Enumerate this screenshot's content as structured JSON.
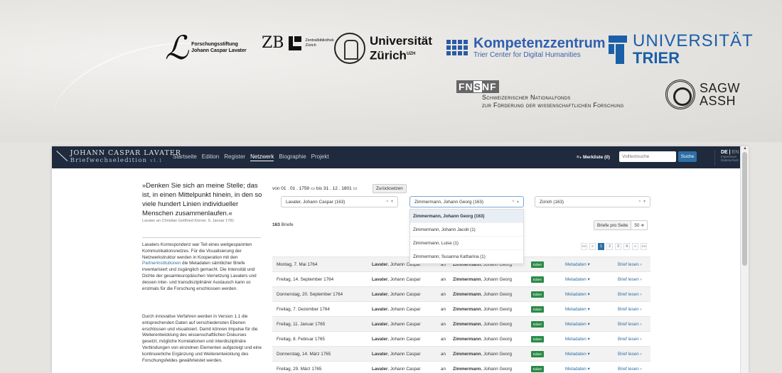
{
  "logos": {
    "lavater": {
      "line1": "Forschungsstiftung",
      "line2": "Johann Caspar Lavater"
    },
    "zb": {
      "mark": "ZB",
      "line1": "Zentralbibliothek",
      "line2": "Zürich"
    },
    "uzh": {
      "line1": "Universität",
      "line2": "Zürich",
      "sup": "UZH"
    },
    "kompetenz": {
      "line1": "Kompetenzzentrum",
      "line2": "Trier Center for Digital Humanities"
    },
    "trier": {
      "line1": "UNIVERSITÄT",
      "line2": "TRIER"
    },
    "snf": {
      "abbr_a": "FN",
      "abbr_b": "S",
      "abbr_c": "NF",
      "line1": "Schweizerischer Nationalfonds",
      "line2": "zur Förderung der wissenschaftlichen Forschung"
    },
    "sagw": {
      "line1": "SAGW",
      "line2": "ASSH"
    }
  },
  "nav": {
    "title": "JOHANN CASPAR LAVATER",
    "subtitle": "Briefwechseledition",
    "version": "v1.1",
    "items": [
      "Startseite",
      "Edition",
      "Register",
      "Netzwerk",
      "Biographie",
      "Projekt"
    ],
    "active": "Netzwerk",
    "merkliste": "≡₊ Merkliste (0)",
    "search_placeholder": "Volltextsuche",
    "search_button": "Suche",
    "lang_de": "DE",
    "lang_en": "EN",
    "impressum": "Impressum",
    "datenschutz": "Datenschutz"
  },
  "sidebar": {
    "quote": "»Denken Sie sich an meine Stelle; das ist, in einen Mittelpunkt hinein, in den so viele hundert Linien individueller Menschen zusammenlaufen.«",
    "quote_source": "Lavater an Christian Gottfried Körner, 9. Januar 1781",
    "para1_a": "Lavaters Korrespondenz war Teil eines weitgespannten Kommunikationsnetzes. Für die Visualisierung der Netzwerkstruktur werden in Kooperation mit den ",
    "para1_link": "Partnerinstitutionen",
    "para1_b": " die Metadaten sämtlicher Briefe inventarisiert und zugänglich gemacht. Die Intensität und Dichte der gesamteuropäischen Vernetzung Lavaters und dessen inter- und transdisziplinärer Austausch kann so erstmals für die Forschung erschlossen werden.",
    "para2": "Durch innovative Verfahren werden in Version 1.1 die entsprechenden Daten auf verschiedensten Ebenen erschlossen und visualisiert. Damit können Impulse für die Weiterentwicklung des wissenschaftlichen Diskurses gesetzt, mögliche Korrelationen und interdisziplinäre Verbindungen von einzelnen Elementen aufgezeigt und eine kontinuierliche Ergänzung und Weiterentwicklung des Forschungsfeldes gewährleistet werden."
  },
  "filters": {
    "von_label": "von",
    "von": "01 . 01 . 1759",
    "bis_label": "bis",
    "bis": "31 . 12 . 1801",
    "reset": "Zurücksetzen",
    "sender": "Lavater, Johann Caspar (163)",
    "recipient": "Zimmermann, Johann Georg (163)",
    "place": "Zürich (163)",
    "dropdown": [
      "Zimmermann, Johann Georg (163)",
      "Zimmermann, Johann Jacob (1)",
      "Zimmermann, Luise (1)",
      "Zimmermann, Susanna Katharina (1)"
    ]
  },
  "results": {
    "count": "163",
    "count_label": "Briefe",
    "per_page_label": "Briefe pro Seite",
    "per_page": "50 ≑",
    "pager": [
      "««",
      "«",
      "1",
      "2",
      "3",
      "4",
      "»",
      "»»"
    ]
  },
  "table": {
    "an": "an",
    "badge": "Ediert",
    "meta": "Metadaten ▾",
    "read": "Brief lesen ›",
    "rows": [
      {
        "date": "Montag, 7. Mai 1764",
        "from_last": "Lavater",
        "from_first": ", Johann Caspar",
        "to_last": "Zimmermann",
        "to_first": ", Johann Georg"
      },
      {
        "date": "Freitag, 14. September 1764",
        "from_last": "Lavater",
        "from_first": ", Johann Caspar",
        "to_last": "Zimmermann",
        "to_first": ", Johann Georg"
      },
      {
        "date": "Donnerstag, 20. September 1764",
        "from_last": "Lavater",
        "from_first": ", Johann Caspar",
        "to_last": "Zimmermann",
        "to_first": ", Johann Georg"
      },
      {
        "date": "Freitag, 7. Dezember 1764",
        "from_last": "Lavater",
        "from_first": ", Johann Caspar",
        "to_last": "Zimmermann",
        "to_first": ", Johann Georg"
      },
      {
        "date": "Freitag, 11. Januar 1765",
        "from_last": "Lavater",
        "from_first": ", Johann Caspar",
        "to_last": "Zimmermann",
        "to_first": ", Johann Georg"
      },
      {
        "date": "Freitag, 8. Februar 1765",
        "from_last": "Lavater",
        "from_first": ", Johann Caspar",
        "to_last": "Zimmermann",
        "to_first": ", Johann Georg"
      },
      {
        "date": "Donnerstag, 14. März 1765",
        "from_last": "Lavater",
        "from_first": ", Johann Caspar",
        "to_last": "Zimmermann",
        "to_first": ", Johann Georg"
      },
      {
        "date": "Freitag, 29. März 1765",
        "from_last": "Lavater",
        "from_first": ", Johann Caspar",
        "to_last": "Zimmermann",
        "to_first": ", Johann Georg"
      }
    ]
  }
}
